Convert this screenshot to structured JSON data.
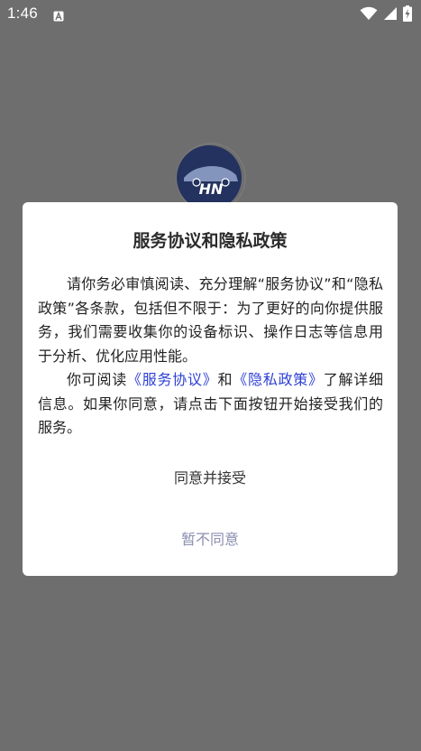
{
  "status_bar": {
    "time": "1:46",
    "notification_icon": "a-letter-icon",
    "icons": [
      "wifi-icon",
      "signal-icon",
      "battery-charging-icon"
    ]
  },
  "app": {
    "logo_text": "HN",
    "logo_icon": "car-logo-icon"
  },
  "dialog": {
    "title": "服务协议和隐私政策",
    "paragraph1": "请你务必审慎阅读、充分理解“服务协议”和“隐私政策”各条款，包括但不限于：为了更好的向你提供服务，我们需要收集你的设备标识、操作日志等信息用于分析、优化应用性能。",
    "paragraph2_prefix": "你可阅读",
    "service_link": "《服务协议》",
    "paragraph2_and": "和",
    "privacy_link": "《隐私政策》",
    "paragraph2_suffix": "了解详细信息。如果你同意，请点击下面按钮开始接受我们的服务。",
    "agree_label": "同意并接受",
    "disagree_label": "暂不同意"
  },
  "colors": {
    "overlay": "#6e6e6e",
    "link": "#2d3fd6",
    "disagree": "#8a8fb0",
    "logo_blue": "#1e4fa0"
  }
}
